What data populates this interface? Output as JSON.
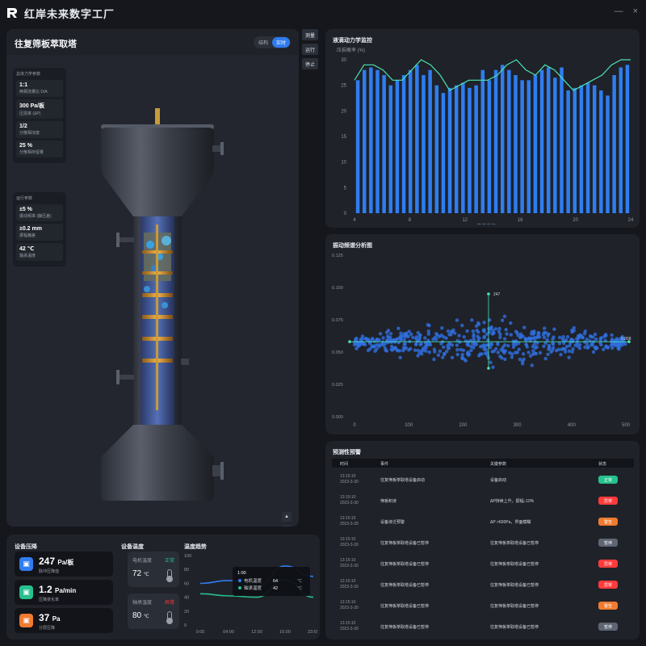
{
  "app": {
    "title": "红岸未来数字工厂",
    "window_controls": [
      "—",
      "×"
    ]
  },
  "viewer": {
    "title": "往复筛板萃取塔",
    "toggle": [
      "结构",
      "实时"
    ],
    "struct_params": {
      "caption": "总体力学参数",
      "items": [
        {
          "value": "1:1",
          "label": "两相流量比 D/A"
        },
        {
          "value": "300 Pa/板",
          "label": "压损率 (ΔP)"
        },
        {
          "value": "1/2",
          "label": "分散相浓度"
        },
        {
          "value": "25 %",
          "label": "分散相存留量"
        }
      ]
    },
    "run_params": {
      "caption": "运行参数",
      "items": [
        {
          "value": "±5 %",
          "label": "振动频率 (静压差)"
        },
        {
          "value": "±0.2 mm",
          "label": "振幅偏差"
        },
        {
          "value": "42 ℃",
          "label": "轴承温度"
        }
      ]
    },
    "side_buttons": [
      "测量",
      "运行",
      "停止"
    ],
    "mini_buttons": [
      "▲",
      "🔒"
    ]
  },
  "bottom": {
    "pressure": {
      "title": "设备压降",
      "cards": [
        {
          "value": "247",
          "unit": "Pa/板",
          "label": "脉冲压降值",
          "color": "#2f7df0",
          "icon": "pump-icon"
        },
        {
          "value": "1.2",
          "unit": "Pa/min",
          "label": "压降变化率",
          "color": "#27c08e",
          "icon": "pump-icon"
        },
        {
          "value": "37",
          "unit": "Pa",
          "label": "分层压降",
          "color": "#f07a2f",
          "icon": "pump-icon"
        }
      ]
    },
    "temperature": {
      "title": "设备温度",
      "cards": [
        {
          "label": "电机温度",
          "status": "正常",
          "status_color": "#27c08e",
          "value": "72",
          "unit": "℃"
        },
        {
          "label": "轴承温度",
          "status": "异常",
          "status_color": "#ff3b3b",
          "value": "80",
          "unit": "℃"
        }
      ]
    },
    "trend": {
      "title": "温度趋势",
      "yticks": [
        "100",
        "80",
        "60",
        "40",
        "20",
        "0"
      ],
      "xticks": [
        "0:00",
        "04:00",
        "12:00",
        "16:00",
        "23:59"
      ],
      "tooltip": {
        "time": "1:00",
        "rows": [
          {
            "name": "电机温度",
            "value": "64",
            "unit": "℃",
            "color": "#2f7df0"
          },
          {
            "name": "轴承温度",
            "value": "42",
            "unit": "℃",
            "color": "#27c08e"
          }
        ]
      }
    }
  },
  "fluid": {
    "title": "液滴动力学监控",
    "ylabel": "压损概率 (%)",
    "xlabel": "液滴直径 (mm)",
    "yticks": [
      "30",
      "25",
      "20",
      "15",
      "10",
      "5",
      "0"
    ],
    "xticks": [
      "4",
      "8",
      "12",
      "16",
      "20",
      "24"
    ]
  },
  "vibration": {
    "title": "振动频谱分析图",
    "yticks": [
      "0.125",
      "0.100",
      "0.075",
      "0.050",
      "0.025",
      "0.000"
    ],
    "xticks": [
      "0",
      "100",
      "200",
      "300",
      "400",
      "500"
    ],
    "crosshair_x_label": "247",
    "crosshair_y_label": "0.058"
  },
  "warnings": {
    "title": "预测性预警",
    "headers": [
      "时间",
      "事件",
      "关键参数",
      "状态"
    ],
    "rows": [
      {
        "time": "13:15:10",
        "date": "2023-3-30",
        "event": "往复筛板萃取塔设备启动",
        "param": "设备启动",
        "status": "正常",
        "color": "#27c08e"
      },
      {
        "time": "13:15:10",
        "date": "2023-3-30",
        "event": "筛板积液",
        "param": "ΔP持续上升，振幅↓10%",
        "status": "异常",
        "color": "#ff3b3b"
      },
      {
        "time": "13:15:10",
        "date": "2023-3-30",
        "event": "设备液泛预警",
        "param": "ΔP >600Pa，界面模糊",
        "status": "警告",
        "color": "#f07a2f"
      },
      {
        "time": "13:15:10",
        "date": "2023-3-30",
        "event": "往复筛板萃取塔设备已暂停",
        "param": "往复筛板萃取塔设备已暂停",
        "status": "暂停",
        "color": "#5e6573"
      },
      {
        "time": "13:15:10",
        "date": "2023-3-30",
        "event": "往复筛板萃取塔设备已暂停",
        "param": "往复筛板萃取塔设备已暂停",
        "status": "异常",
        "color": "#ff3b3b"
      },
      {
        "time": "13:15:10",
        "date": "2023-3-30",
        "event": "往复筛板萃取塔设备已暂停",
        "param": "往复筛板萃取塔设备已暂停",
        "status": "异常",
        "color": "#ff3b3b"
      },
      {
        "time": "13:15:10",
        "date": "2023-3-30",
        "event": "往复筛板萃取塔设备已暂停",
        "param": "往复筛板萃取塔设备已暂停",
        "status": "警告",
        "color": "#f07a2f"
      },
      {
        "time": "13:15:10",
        "date": "2023-3-30",
        "event": "往复筛板萃取塔设备已暂停",
        "param": "往复筛板萃取塔设备已暂停",
        "status": "暂停",
        "color": "#5e6573"
      }
    ]
  },
  "chart_data": [
    {
      "type": "bar",
      "title": "液滴动力学监控",
      "xlabel": "液滴直径 (mm)",
      "ylabel": "压损概率 (%)",
      "xlim": [
        4,
        24
      ],
      "ylim": [
        0,
        30
      ],
      "x": [
        4,
        4.5,
        5,
        5.5,
        6,
        6.5,
        7,
        7.5,
        8,
        8.5,
        9,
        9.5,
        10,
        10.5,
        11,
        11.5,
        12,
        12.5,
        13,
        13.5,
        14,
        14.5,
        15,
        15.5,
        16,
        16.5,
        17,
        17.5,
        18,
        18.5,
        19,
        19.5,
        20,
        20.5,
        21,
        21.5,
        22,
        22.5,
        23,
        23.5,
        24
      ],
      "values": [
        26,
        28,
        28.5,
        28,
        27,
        25,
        26,
        27,
        28,
        29,
        27,
        28,
        25,
        23.5,
        24.5,
        25,
        25.5,
        24.5,
        25,
        28,
        26,
        28,
        29,
        28,
        27,
        26,
        26,
        27,
        28,
        28.5,
        26.5,
        28.5,
        24,
        24.5,
        25,
        25.5,
        25,
        24,
        23,
        27,
        28.5,
        29
      ],
      "series": [
        {
          "type": "line",
          "values": [
            26,
            29,
            29,
            28,
            26,
            26,
            28,
            30,
            29,
            27,
            24,
            25,
            26,
            26,
            26,
            27,
            29,
            30,
            28,
            27,
            29,
            28,
            26,
            24,
            25,
            26,
            27,
            29,
            30,
            30
          ]
        }
      ]
    },
    {
      "type": "scatter",
      "title": "振动频谱分析图",
      "xlim": [
        0,
        500
      ],
      "ylim": [
        0,
        0.125
      ],
      "x_center": 247,
      "y_center": 0.058
    },
    {
      "type": "line",
      "title": "温度趋势",
      "categories": [
        "0:00",
        "04:00",
        "12:00",
        "16:00",
        "23:59"
      ],
      "ylim": [
        0,
        100
      ],
      "series": [
        {
          "name": "电机温度",
          "values": [
            60,
            64,
            55,
            85,
            70
          ]
        },
        {
          "name": "轴承温度",
          "values": [
            45,
            42,
            40,
            65,
            40
          ]
        }
      ]
    }
  ]
}
